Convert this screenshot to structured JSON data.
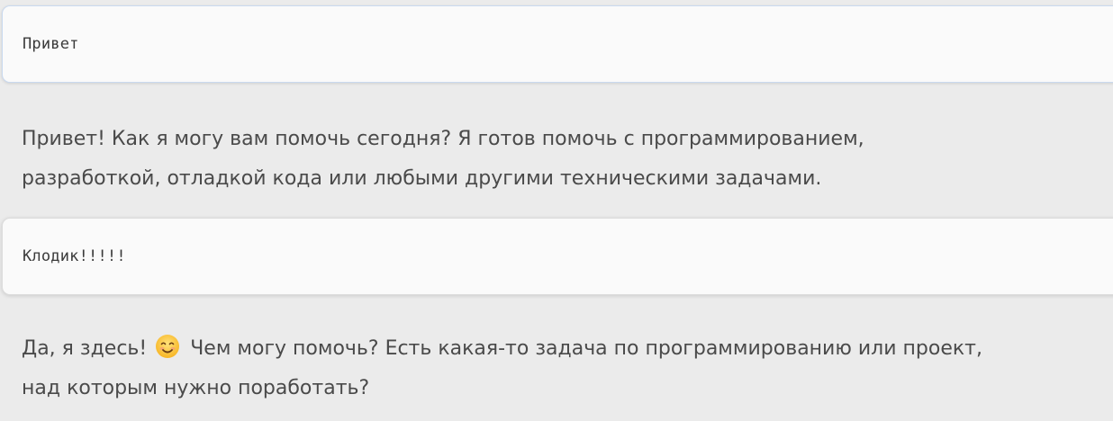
{
  "conversation": {
    "messages": [
      {
        "role": "user",
        "text": "Привет"
      },
      {
        "role": "assistant",
        "line1": "Привет! Как я могу вам помочь сегодня? Я готов помочь с программированием,",
        "line2": "разработкой, отладкой кода или любыми другими техническими задачами."
      },
      {
        "role": "user",
        "text": "Клодик!!!!!"
      },
      {
        "role": "assistant",
        "before_emoji": "Да, я здесь! ",
        "after_emoji": " Чем могу помочь? Есть какая-то задача по программированию или проект,",
        "line2": "над которым нужно поработать?",
        "emoji": "smiling-face-icon"
      }
    ]
  },
  "colors": {
    "background": "#ebebeb",
    "user_bubble": "#fafafa",
    "assistant_text": "#4a4a4a",
    "user_text": "#3a3a3a"
  }
}
